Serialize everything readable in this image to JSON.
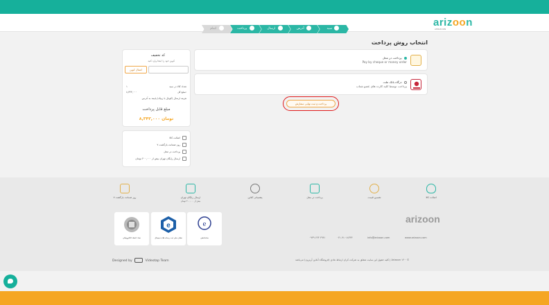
{
  "header": {
    "logo_text": "arizoon",
    "logo_tagline": "AHRIZOON",
    "steps": [
      {
        "label": "سبد",
        "active": true
      },
      {
        "label": "آدرس",
        "active": true
      },
      {
        "label": "ارسال",
        "active": true
      },
      {
        "label": "پرداخت",
        "active": true
      },
      {
        "label": "اتمام",
        "active": false
      }
    ]
  },
  "main": {
    "title": "انتخاب روش پرداخت",
    "payment_methods": [
      {
        "label": "پرداخت در محل",
        "description": "Pay by cheque or money order",
        "selected": true,
        "icon": "cash-on-delivery-icon"
      },
      {
        "label": "درگاه بانک ملت",
        "description": "پرداخت توسط کلیه کارت های عضو شتاب",
        "selected": false,
        "icon": "mellat-bank-icon"
      }
    ],
    "submit_label": "پرداخت و ثبت نهایی سفارش"
  },
  "sidebar": {
    "discount": {
      "title": "کد تخفیف",
      "subtitle": "کوپن خود را اینجا وارد کنید",
      "placeholder": "",
      "apply_label": "اعمال کوپن"
    },
    "summary": {
      "count_label": "تعداد کالا در سبد",
      "count_value": "۱",
      "total_label": "مبلغ کل:",
      "total_value": "۸,۳۴۳,۰۰۰",
      "shipping_label": "هزینه ارسال (کوپال با زیپک) پایبند به آدرس",
      "payable_label": "مبلغ قابل پرداخت",
      "payable_value": "۸,۳۴۳,۰۰۰ تومان"
    },
    "features": [
      "اصالت کالا",
      "۷ روز ضمانت بازگشت",
      "پرداخت در محل",
      "ارسال رایگان تهران بیش از ۲۰۰,۰۰۰ تومان"
    ]
  },
  "footer": {
    "features": [
      {
        "label": "اصالت کالا",
        "icon": "shield-check-icon"
      },
      {
        "label": "تضمین قیمت",
        "icon": "price-badge-icon"
      },
      {
        "label": "پرداخت در محل",
        "icon": "cash-hand-icon"
      },
      {
        "label": "پشتیبانی آنلاین",
        "icon": "support-headset-icon"
      },
      {
        "label": "ارسال رایگان تهران",
        "sub": "بیش از ۲۰۰,۰۰۰ تومان",
        "icon": "delivery-truck-icon"
      },
      {
        "label": "۷ روز ضمانت بازگشت",
        "icon": "return-box-icon"
      }
    ],
    "badges": [
      {
        "name": "enamad",
        "text": "نماد اعتماد الکترونیکی"
      },
      {
        "name": "ecunion",
        "text": "نشان ملی ثبت رسانه های دیجیتال"
      },
      {
        "name": "samandehi",
        "text": "ساماندهی"
      }
    ],
    "logo_text": "arizoon",
    "contact": {
      "website": "www.arizoon.com",
      "email": "info@arizoon.com",
      "phone": "۰۲۱-۹۱۰۱۸۳۳۳",
      "mobile": "۰۹۳۹ ۶۲۳ ۲۹۴۱"
    },
    "designed_by": "Designed by",
    "designer": "Videotap Team",
    "copyright": "کلیه حقوق این سایت متعلق به شرکت کران ارتباط هادی (فروشگاه آنلاین آریزون) می‌باشد | Arizoon ۱۴۰۰©"
  }
}
